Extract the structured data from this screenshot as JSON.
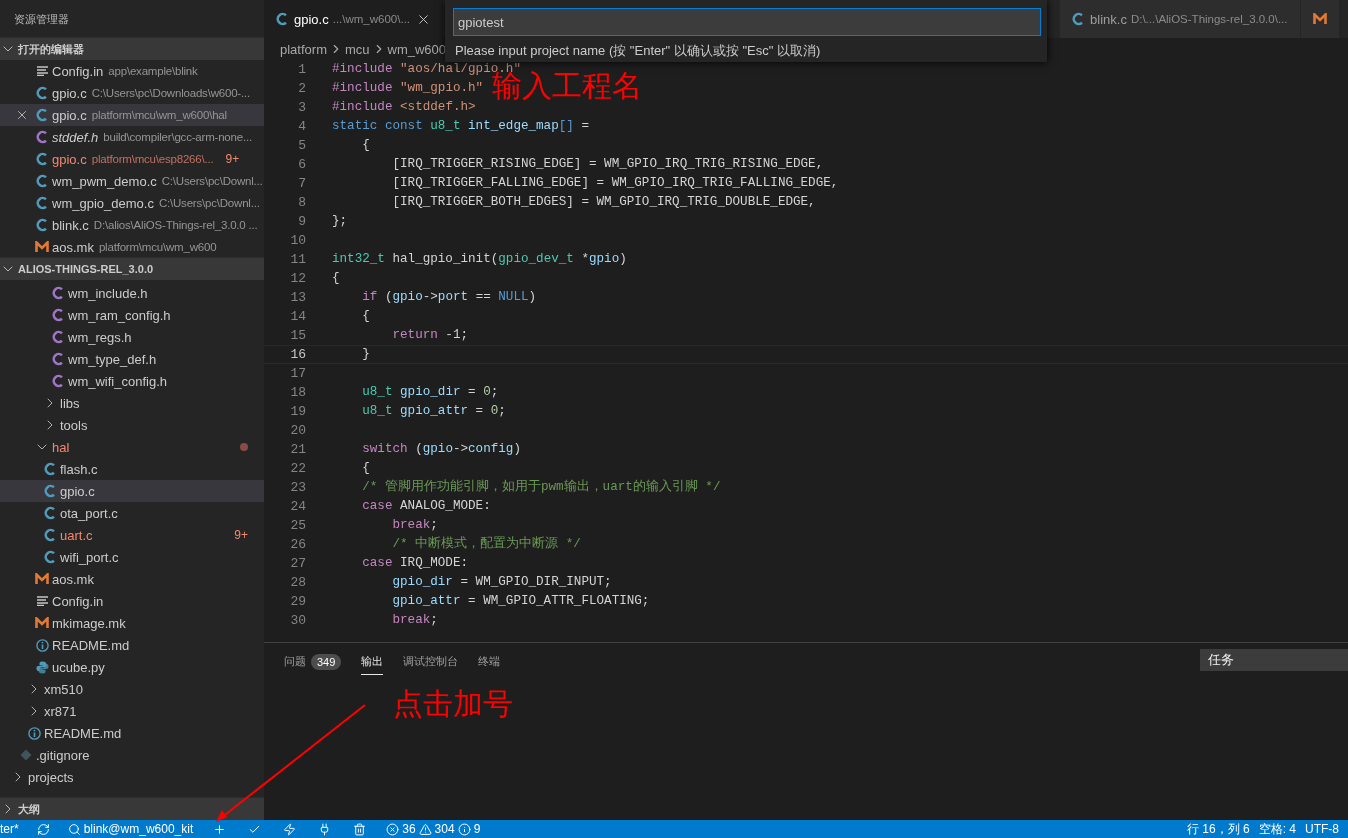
{
  "sidebar": {
    "title": "资源管理器",
    "sections": [
      {
        "kind": "open_editors",
        "title": "打开的编辑器",
        "expanded": true,
        "items": [
          {
            "kind": "config_file",
            "name": "Config.in",
            "path": "app\\example\\blink",
            "italic": false,
            "error": false,
            "selected": false
          },
          {
            "kind": "c_file",
            "name": "gpio.c",
            "path": "C:\\Users\\pc\\Downloads\\w600-...",
            "italic": false,
            "error": false,
            "selected": false
          },
          {
            "kind": "c_file",
            "name": "gpio.c",
            "path": "platform\\mcu\\wm_w600\\hal",
            "italic": false,
            "error": false,
            "selected": true
          },
          {
            "kind": "header_file",
            "name": "stddef.h",
            "path": "build\\compiler\\gcc-arm-none...",
            "italic": true,
            "error": false,
            "selected": false
          },
          {
            "kind": "c_file",
            "name": "gpio.c",
            "path": "platform\\mcu\\esp8266\\...",
            "italic": false,
            "error": true,
            "badge": "9+",
            "selected": false
          },
          {
            "kind": "c_file",
            "name": "wm_pwm_demo.c",
            "path": "C:\\Users\\pc\\Downl...",
            "italic": false,
            "error": false,
            "selected": false
          },
          {
            "kind": "c_file",
            "name": "wm_gpio_demo.c",
            "path": "C:\\Users\\pc\\Downl...",
            "italic": false,
            "error": false,
            "selected": false
          },
          {
            "kind": "c_file",
            "name": "blink.c",
            "path": "D:\\alios\\AliOS-Things-rel_3.0.0 ...",
            "italic": false,
            "error": false,
            "selected": false
          },
          {
            "kind": "makefile",
            "name": "aos.mk",
            "path": "platform\\mcu\\wm_w600",
            "italic": false,
            "error": false,
            "selected": false
          }
        ]
      },
      {
        "kind": "tree",
        "title": "ALIOS-THINGS-REL_3.0.0",
        "expanded": true,
        "items": [
          {
            "kind": "offscreen",
            "children": [
              {
                "kind": "offscreen",
                "children": [
                  {
                    "kind": "offscreen",
                    "children": [
                      {
                        "kind": "offscreen",
                        "children": [
                          {
                            "kind": "offscreen",
                            "children": [
                              {
                                "kind": "header_file",
                                "name": "wm_include.h",
                                "selected": false,
                                "error": false
                              },
                              {
                                "kind": "header_file",
                                "name": "wm_ram_config.h",
                                "selected": false,
                                "error": false
                              },
                              {
                                "kind": "header_file",
                                "name": "wm_regs.h",
                                "selected": false,
                                "error": false
                              },
                              {
                                "kind": "header_file",
                                "name": "wm_type_def.h",
                                "selected": false,
                                "error": false
                              },
                              {
                                "kind": "header_file",
                                "name": "wm_wifi_config.h",
                                "selected": false,
                                "error": false
                              }
                            ]
                          },
                          {
                            "kind": "folder",
                            "name": "libs",
                            "expanded": false,
                            "selected": false,
                            "error": false
                          },
                          {
                            "kind": "folder",
                            "name": "tools",
                            "expanded": false,
                            "selected": false,
                            "error": false
                          }
                        ]
                      },
                      {
                        "kind": "folder",
                        "name": "hal",
                        "expanded": true,
                        "selected": false,
                        "error": true,
                        "children": [
                          {
                            "kind": "c_file",
                            "name": "flash.c",
                            "selected": false,
                            "error": false
                          },
                          {
                            "kind": "c_file",
                            "name": "gpio.c",
                            "selected": true,
                            "error": false
                          },
                          {
                            "kind": "c_file",
                            "name": "ota_port.c",
                            "selected": false,
                            "error": false
                          },
                          {
                            "kind": "c_file",
                            "name": "uart.c",
                            "selected": false,
                            "error": true,
                            "badge": "9+"
                          },
                          {
                            "kind": "c_file",
                            "name": "wifi_port.c",
                            "selected": false,
                            "error": false
                          }
                        ]
                      },
                      {
                        "kind": "makefile",
                        "name": "aos.mk",
                        "selected": false,
                        "error": false
                      },
                      {
                        "kind": "config_file",
                        "name": "Config.in",
                        "selected": false,
                        "error": false
                      },
                      {
                        "kind": "makefile",
                        "name": "mkimage.mk",
                        "selected": false,
                        "error": false
                      },
                      {
                        "kind": "readme",
                        "name": "README.md",
                        "selected": false,
                        "error": false
                      },
                      {
                        "kind": "python_file",
                        "name": "ucube.py",
                        "selected": false,
                        "error": false
                      }
                    ]
                  },
                  {
                    "kind": "folder",
                    "name": "xm510",
                    "expanded": false,
                    "selected": false,
                    "error": false
                  },
                  {
                    "kind": "folder",
                    "name": "xr871",
                    "expanded": false,
                    "selected": false,
                    "error": false
                  },
                  {
                    "kind": "readme",
                    "name": "README.md",
                    "selected": false,
                    "error": false
                  }
                ]
              },
              {
                "kind": "gitignore",
                "name": ".gitignore",
                "selected": false,
                "error": false
              }
            ]
          },
          {
            "kind": "folder",
            "name": "projects",
            "expanded": false,
            "selected": false,
            "error": false
          }
        ]
      },
      {
        "kind": "outline",
        "title": "大纲",
        "expanded": false
      }
    ]
  },
  "editor": {
    "tabs": [
      {
        "kind": "c_file",
        "name": "gpio.c",
        "path": "...\\wm_w600\\...",
        "selected": true
      },
      {
        "kind": "c_file",
        "name": "blink.c",
        "path": "D:\\...\\AliOS-Things-rel_3.0.0\\...",
        "selected": false
      },
      {
        "kind": "makefile",
        "selected": false
      }
    ],
    "breadcrumb": [
      "platform",
      "mcu",
      "wm_w600"
    ],
    "lines": [
      {
        "number": "1",
        "current": false,
        "tokens": [
          {
            "kind": "p",
            "text": "#include "
          },
          {
            "kind": "s",
            "text": "\"aos/hal/gpio.h\""
          }
        ]
      },
      {
        "number": "2",
        "current": false,
        "tokens": [
          {
            "kind": "p",
            "text": "#include "
          },
          {
            "kind": "s",
            "text": "\"wm_gpio.h\""
          }
        ]
      },
      {
        "number": "3",
        "current": false,
        "tokens": [
          {
            "kind": "p",
            "text": "#include "
          },
          {
            "kind": "s",
            "text": "<stddef.h>"
          }
        ]
      },
      {
        "number": "4",
        "current": false,
        "tokens": [
          {
            "kind": "k",
            "text": "static const "
          },
          {
            "kind": "t",
            "text": "u8_t "
          },
          {
            "kind": "v",
            "text": "int_edge_map"
          },
          {
            "kind": "k",
            "text": "[]"
          },
          {
            "kind": "x",
            "text": " ="
          }
        ]
      },
      {
        "number": "5",
        "current": false,
        "tokens": [
          {
            "kind": "x",
            "text": "    {"
          }
        ]
      },
      {
        "number": "6",
        "current": false,
        "tokens": [
          {
            "kind": "x",
            "text": "        [IRQ_TRIGGER_RISING_EDGE] = WM_GPIO_IRQ_TRIG_RISING_EDGE,"
          }
        ]
      },
      {
        "number": "7",
        "current": false,
        "tokens": [
          {
            "kind": "x",
            "text": "        [IRQ_TRIGGER_FALLING_EDGE] = WM_GPIO_IRQ_TRIG_FALLING_EDGE,"
          }
        ]
      },
      {
        "number": "8",
        "current": false,
        "tokens": [
          {
            "kind": "x",
            "text": "        [IRQ_TRIGGER_BOTH_EDGES] = WM_GPIO_IRQ_TRIG_DOUBLE_EDGE,"
          }
        ]
      },
      {
        "number": "9",
        "current": false,
        "tokens": [
          {
            "kind": "x",
            "text": "};"
          }
        ]
      },
      {
        "number": "10",
        "current": false
      },
      {
        "number": "11",
        "current": false,
        "tokens": [
          {
            "kind": "t",
            "text": "int32_t"
          },
          {
            "kind": "x",
            "text": " hal_gpio_init("
          },
          {
            "kind": "t",
            "text": "gpio_dev_t"
          },
          {
            "kind": "x",
            "text": " *"
          },
          {
            "kind": "v",
            "text": "gpio"
          },
          {
            "kind": "x",
            "text": ")"
          }
        ]
      },
      {
        "number": "12",
        "current": false,
        "tokens": [
          {
            "kind": "x",
            "text": "{"
          }
        ]
      },
      {
        "number": "13",
        "current": false,
        "tokens": [
          {
            "kind": "c",
            "text": "    if"
          },
          {
            "kind": "x",
            "text": " ("
          },
          {
            "kind": "v",
            "text": "gpio"
          },
          {
            "kind": "x",
            "text": "->"
          },
          {
            "kind": "v",
            "text": "port"
          },
          {
            "kind": "x",
            "text": " == "
          },
          {
            "kind": "k",
            "text": "NULL"
          },
          {
            "kind": "x",
            "text": ")"
          }
        ]
      },
      {
        "number": "14",
        "current": false,
        "tokens": [
          {
            "kind": "x",
            "text": "    {"
          }
        ]
      },
      {
        "number": "15",
        "current": false,
        "tokens": [
          {
            "kind": "c",
            "text": "        return"
          },
          {
            "kind": "x",
            "text": " -1;"
          }
        ]
      },
      {
        "number": "16",
        "current": true,
        "tokens": [
          {
            "kind": "x",
            "text": "    }"
          }
        ]
      },
      {
        "number": "17",
        "current": false
      },
      {
        "number": "18",
        "current": false,
        "tokens": [
          {
            "kind": "t",
            "text": "    u8_t "
          },
          {
            "kind": "v",
            "text": "gpio_dir"
          },
          {
            "kind": "x",
            "text": " = "
          },
          {
            "kind": "n",
            "text": "0"
          },
          {
            "kind": "x",
            "text": ";"
          }
        ]
      },
      {
        "number": "19",
        "current": false,
        "tokens": [
          {
            "kind": "t",
            "text": "    u8_t "
          },
          {
            "kind": "v",
            "text": "gpio_attr"
          },
          {
            "kind": "x",
            "text": " = "
          },
          {
            "kind": "n",
            "text": "0"
          },
          {
            "kind": "x",
            "text": ";"
          }
        ]
      },
      {
        "number": "20",
        "current": false
      },
      {
        "number": "21",
        "current": false,
        "tokens": [
          {
            "kind": "c",
            "text": "    switch"
          },
          {
            "kind": "x",
            "text": " ("
          },
          {
            "kind": "v",
            "text": "gpio"
          },
          {
            "kind": "x",
            "text": "->"
          },
          {
            "kind": "v",
            "text": "config"
          },
          {
            "kind": "x",
            "text": ")"
          }
        ]
      },
      {
        "number": "22",
        "current": false,
        "tokens": [
          {
            "kind": "x",
            "text": "    {"
          }
        ]
      },
      {
        "number": "23",
        "current": false,
        "tokens": [
          {
            "kind": "m",
            "text": "    /* 管脚用作功能引脚，如用于pwm输出，uart的输入引脚 */"
          }
        ]
      },
      {
        "number": "24",
        "current": false,
        "tokens": [
          {
            "kind": "c",
            "text": "    case"
          },
          {
            "kind": "x",
            "text": " ANALOG_MODE:"
          }
        ]
      },
      {
        "number": "25",
        "current": false,
        "tokens": [
          {
            "kind": "c",
            "text": "        break"
          },
          {
            "kind": "x",
            "text": ";"
          }
        ]
      },
      {
        "number": "26",
        "current": false,
        "tokens": [
          {
            "kind": "m",
            "text": "        /* 中断模式，配置为中断源 */"
          }
        ]
      },
      {
        "number": "27",
        "current": false,
        "tokens": [
          {
            "kind": "c",
            "text": "    case"
          },
          {
            "kind": "x",
            "text": " IRQ_MODE:"
          }
        ]
      },
      {
        "number": "28",
        "current": false,
        "tokens": [
          {
            "kind": "v",
            "text": "        gpio_dir"
          },
          {
            "kind": "x",
            "text": " = WM_GPIO_DIR_INPUT;"
          }
        ]
      },
      {
        "number": "29",
        "current": false,
        "tokens": [
          {
            "kind": "v",
            "text": "        gpio_attr"
          },
          {
            "kind": "x",
            "text": " = WM_GPIO_ATTR_FLOATING;"
          }
        ]
      },
      {
        "number": "30",
        "current": false,
        "tokens": [
          {
            "kind": "c",
            "text": "        break"
          },
          {
            "kind": "x",
            "text": ";"
          }
        ]
      }
    ]
  },
  "quick_input": {
    "value": "gpiotest",
    "message": "Please input project name (按 \"Enter\" 以确认或按 \"Esc\" 以取消)"
  },
  "panel": {
    "tabs": [
      {
        "label": "问题",
        "badge": "349",
        "selected": false
      },
      {
        "label": "输出",
        "selected": true
      },
      {
        "label": "调试控制台",
        "selected": false
      },
      {
        "label": "终端",
        "selected": false
      }
    ],
    "task_select": "任务"
  },
  "status_bar": {
    "left": [
      {
        "kind": "text",
        "text": "ter*"
      },
      {
        "kind": "sync"
      },
      {
        "kind": "search",
        "text": "blink@wm_w600_kit"
      },
      {
        "kind": "add"
      },
      {
        "kind": "check"
      },
      {
        "kind": "bolt"
      },
      {
        "kind": "plug"
      },
      {
        "kind": "trash"
      },
      {
        "kind": "problems",
        "errors": "36",
        "warnings": "304",
        "infos": "9"
      }
    ],
    "right": [
      {
        "kind": "text",
        "text": "行 16，列 6"
      },
      {
        "kind": "text",
        "text": "空格: 4"
      },
      {
        "kind": "text",
        "text": "UTF-8"
      }
    ]
  },
  "annotations": [
    {
      "kind": "label",
      "text": "输入工程名"
    },
    {
      "kind": "label",
      "text": "点击加号"
    },
    {
      "kind": "arrow"
    }
  ]
}
